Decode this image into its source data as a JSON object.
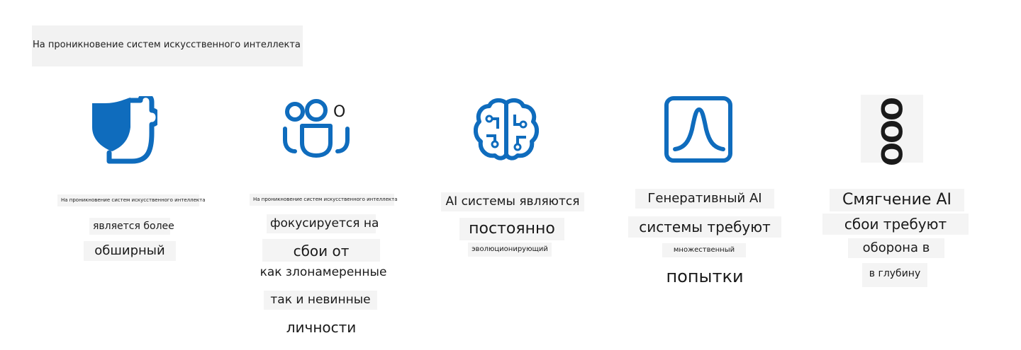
{
  "banner": {
    "text": "На проникновение систем искусственного интеллекта"
  },
  "icons": {
    "shield_puzzle": {
      "name": "shield-puzzle-icon",
      "color": "#0f6cbd"
    },
    "people": {
      "name": "people-group-icon",
      "color": "#0f6cbd",
      "badge": "O"
    },
    "brain": {
      "name": "brain-circuit-icon",
      "color": "#0f6cbd"
    },
    "curve": {
      "name": "bell-curve-icon",
      "color": "#0f6cbd"
    },
    "dots": {
      "name": "three-circles-icon",
      "color": "#1a1a1a",
      "glyph": "OOO"
    }
  },
  "columns": [
    {
      "lines": [
        "На проникновение систем искусственного интеллекта",
        "является более",
        "обширный"
      ]
    },
    {
      "lines": [
        "На проникновение систем искусственного интеллекта",
        "фокусируется на",
        "сбои от",
        "как злонамеренные",
        "так и невинные",
        "личности"
      ]
    },
    {
      "lines": [
        "AI системы являются",
        "постоянно",
        "эволюционирующий"
      ]
    },
    {
      "lines": [
        "Генеративный AI",
        "системы требуют",
        "множественный",
        "попытки"
      ]
    },
    {
      "lines": [
        "Смягчение AI",
        "сбои требуют",
        "оборона в",
        "в глубину"
      ]
    }
  ]
}
